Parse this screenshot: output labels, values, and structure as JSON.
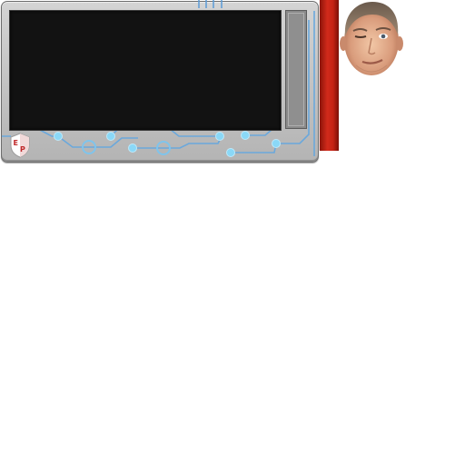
{
  "app": {
    "screen_content": "",
    "logo_letters": "EP"
  },
  "colors": {
    "panel": "#c6c6c6",
    "screen": "#121212",
    "circuit_trace": "#5aa9e6",
    "circuit_node": "#7fd1f5",
    "red_bar": "#c52214"
  },
  "icons": {
    "logo": "shield-logo-icon",
    "face": "face-avatar-icon"
  }
}
